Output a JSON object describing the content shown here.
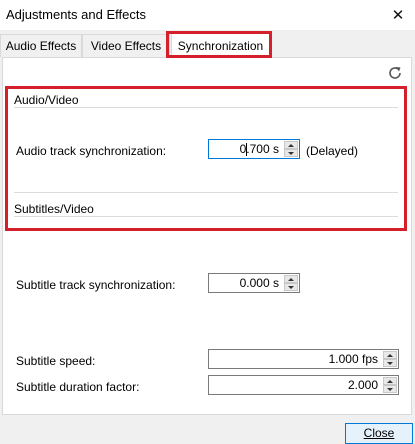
{
  "window": {
    "title": "Adjustments and Effects",
    "close_glyph": "✕"
  },
  "tabs": [
    {
      "label": "Audio Effects",
      "active": false
    },
    {
      "label": "Video Effects",
      "active": false
    },
    {
      "label": "Synchronization",
      "active": true
    }
  ],
  "toolbar": {
    "reset_icon": "refresh-icon"
  },
  "audio_video": {
    "group_title": "Audio/Video",
    "audio_track_sync_label": "Audio track synchronization:",
    "audio_track_sync_value": "0.700 s",
    "audio_track_sync_status": "(Delayed)"
  },
  "subtitles_video": {
    "group_title": "Subtitles/Video",
    "subtitle_track_sync_label": "Subtitle track synchronization:",
    "subtitle_track_sync_value": "0.000 s",
    "subtitle_speed_label": "Subtitle speed:",
    "subtitle_speed_value": "1.000 fps",
    "subtitle_duration_label": "Subtitle duration factor:",
    "subtitle_duration_value": "2.000"
  },
  "footer": {
    "close_label": "Close"
  },
  "colors": {
    "highlight": "#d3202a",
    "focus": "#0078d7"
  }
}
